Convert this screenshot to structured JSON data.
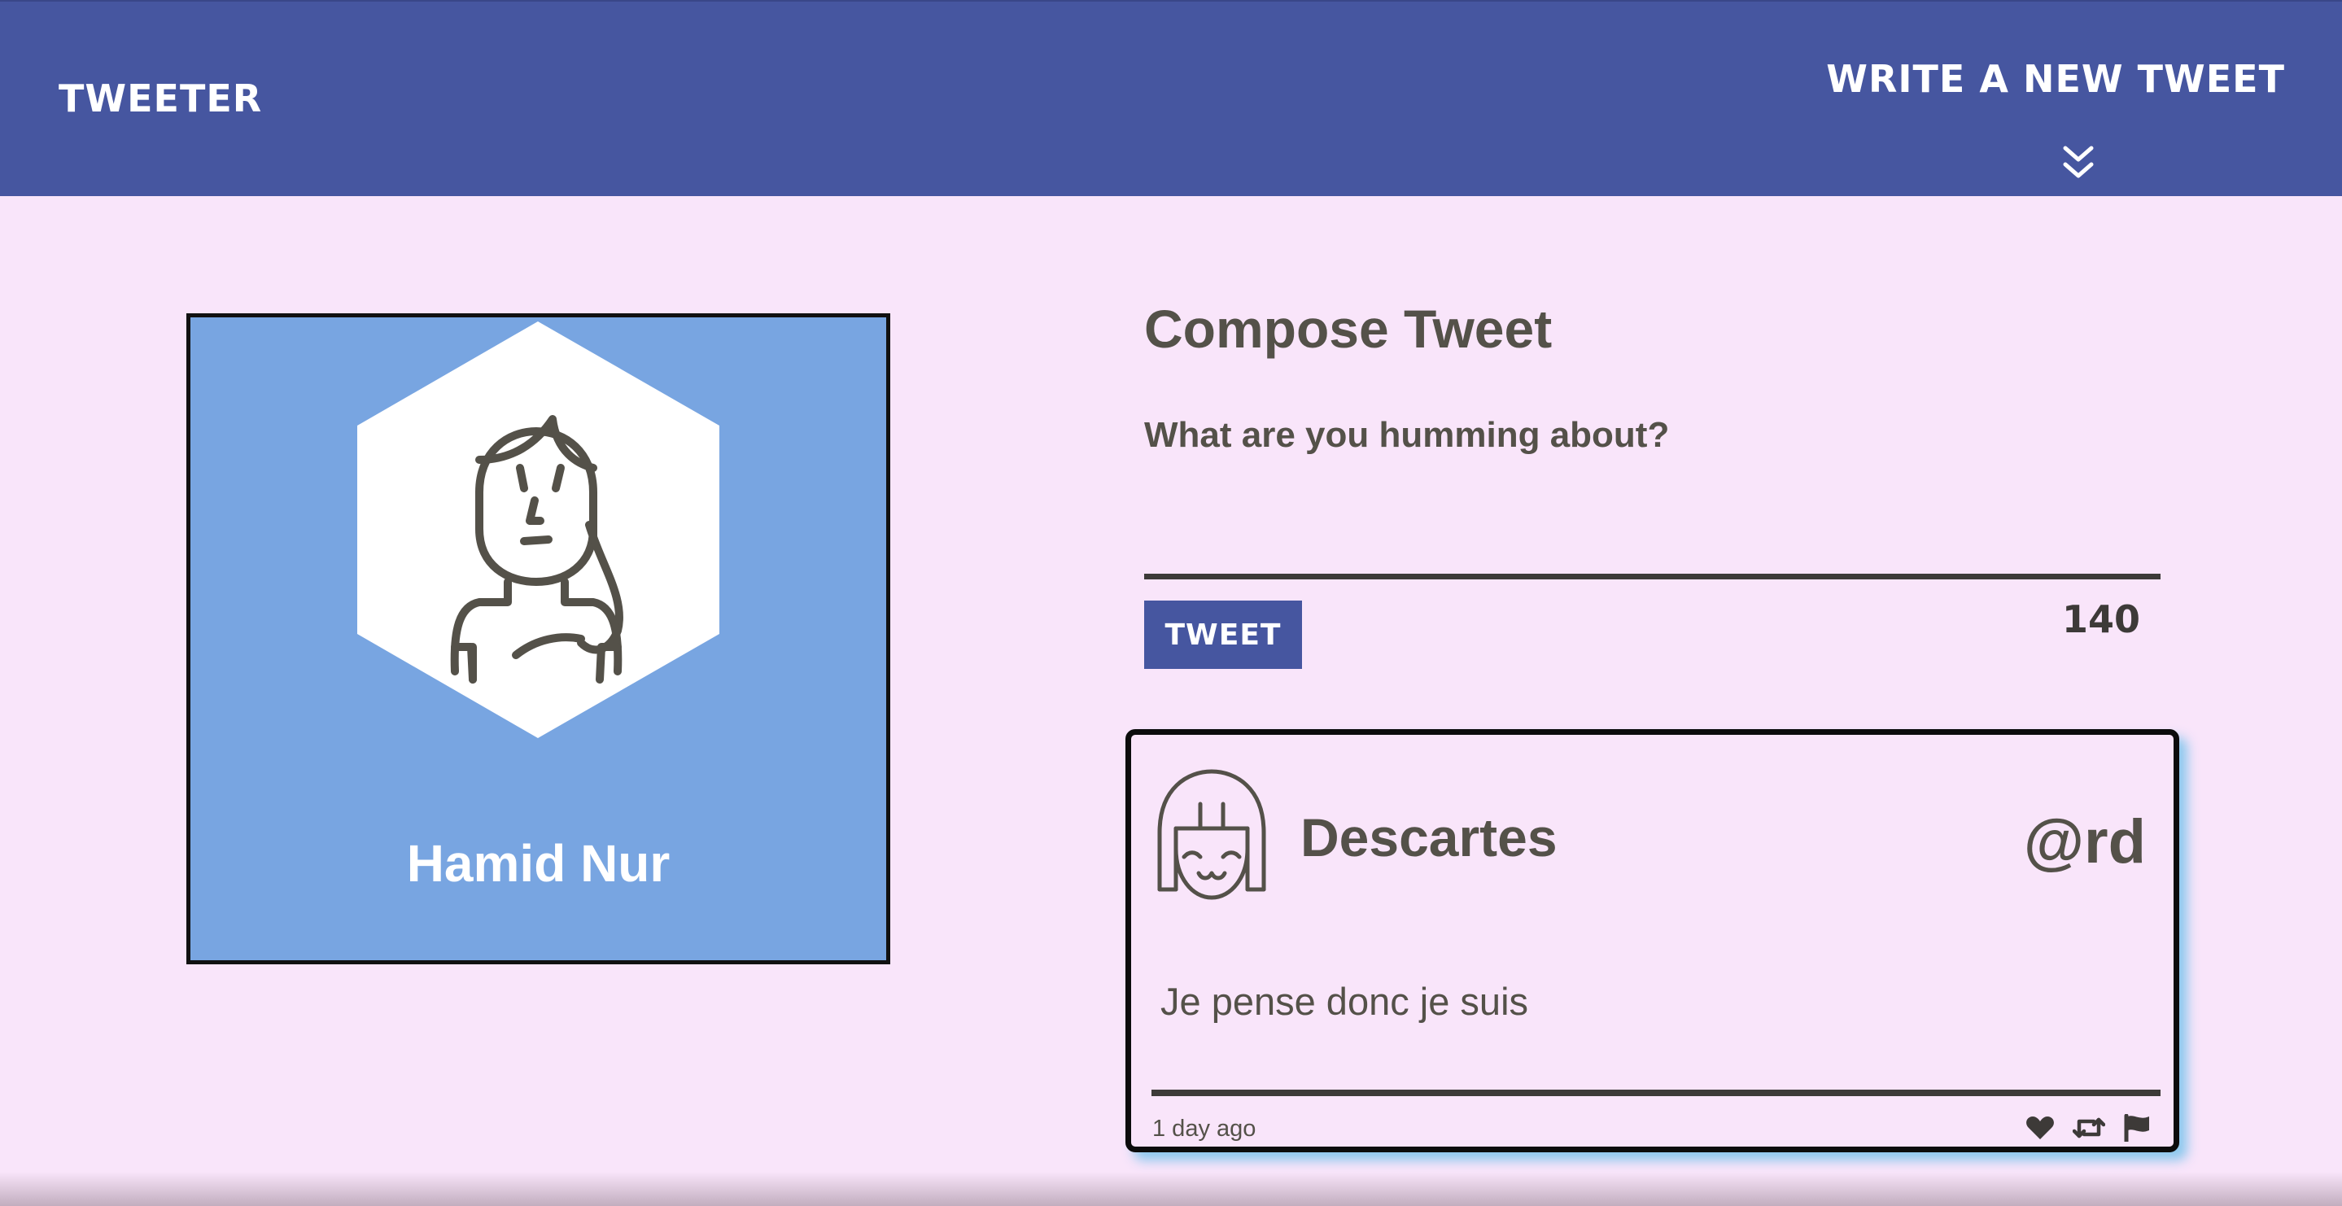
{
  "nav": {
    "brand": "Tweeter",
    "new_tweet_label": "Write a new tweet",
    "toggle_icon": "double-chevron-down-icon"
  },
  "profile": {
    "name": "Hamid Nur",
    "avatar_icon": "user-avatar-icon",
    "background_color": "#78a5e1"
  },
  "compose": {
    "title": "Compose Tweet",
    "label": "What are you humming about?",
    "input_value": "",
    "button_label": "Tweet",
    "counter": "140"
  },
  "tweets": [
    {
      "author": "Descartes",
      "handle": "@rd",
      "text": "Je pense donc je suis",
      "time": "1 day ago",
      "avatar_icon": "user-avatar-icon",
      "actions": [
        "heart-icon",
        "retweet-icon",
        "flag-icon"
      ]
    }
  ],
  "colors": {
    "nav_background": "#4656a0",
    "page_background": "#f9e5fa",
    "text": "#545149",
    "tweet_shadow": "#78c3eb"
  }
}
